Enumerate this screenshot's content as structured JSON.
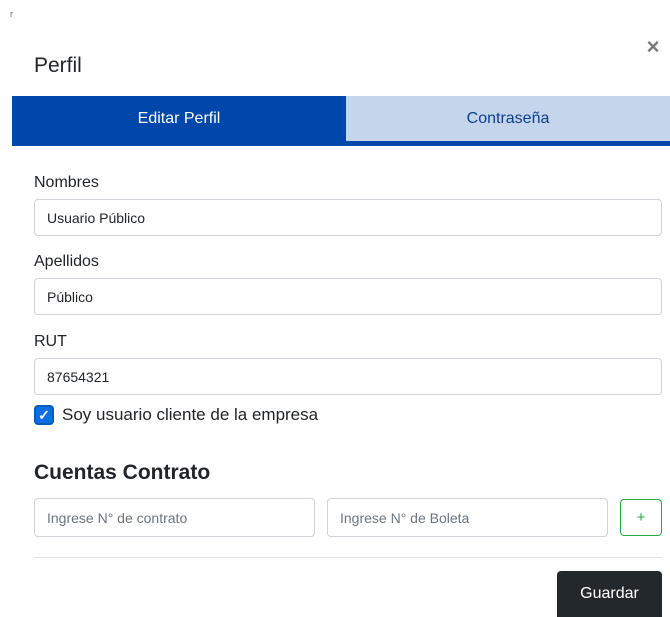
{
  "modal": {
    "corner_mark": "r",
    "title": "Perfil",
    "close_icon": "×"
  },
  "tabs": [
    {
      "label": "Editar Perfil",
      "active": true
    },
    {
      "label": "Contraseña",
      "active": false
    }
  ],
  "form": {
    "nombres": {
      "label": "Nombres",
      "value": "Usuario Público"
    },
    "apellidos": {
      "label": "Apellidos",
      "value": "Público"
    },
    "rut": {
      "label": "RUT",
      "value": "87654321"
    },
    "cliente_checkbox": {
      "label": "Soy usuario cliente de la empresa",
      "checked": true,
      "check_glyph": "✓"
    }
  },
  "contracts": {
    "title": "Cuentas Contrato",
    "contract_placeholder": "Ingrese N° de contrato",
    "boleta_placeholder": "Ingrese N° de Boleta",
    "add_label": "+"
  },
  "footer": {
    "save_label": "Guardar"
  },
  "colors": {
    "primary": "#0047ab",
    "tab_inactive_bg": "#c5d5ec",
    "success": "#28a745",
    "dark_button": "#23282d"
  }
}
